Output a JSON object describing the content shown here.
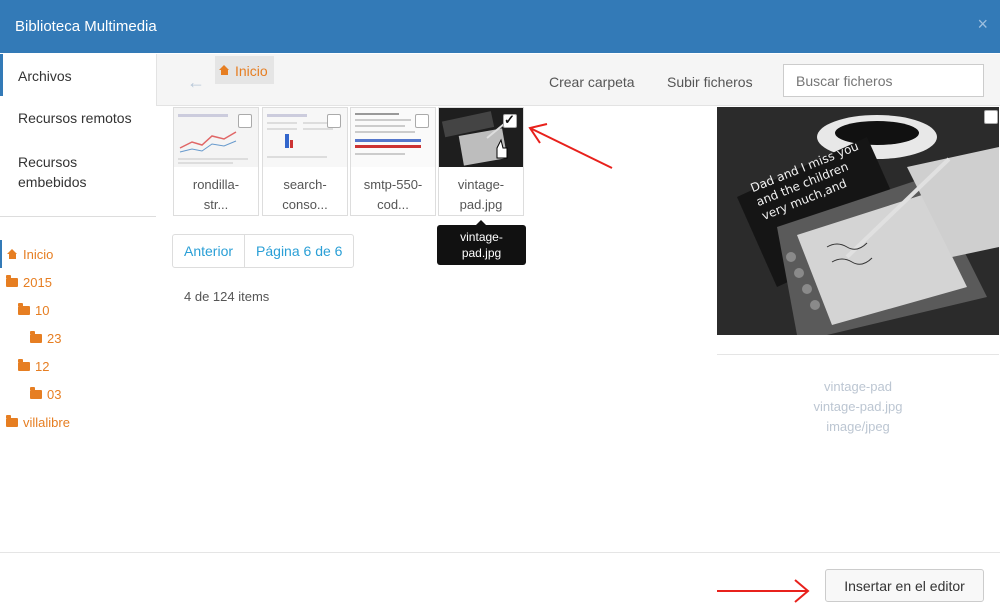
{
  "header": {
    "title": "Biblioteca Multimedia",
    "close": "×"
  },
  "sidebar": {
    "tabs": [
      {
        "label": "Archivos"
      },
      {
        "label": "Recursos remotos"
      },
      {
        "label": "Recursos embebidos"
      }
    ]
  },
  "tree": {
    "items": [
      {
        "label": "Inicio",
        "icon": "home-icon"
      },
      {
        "label": "2015",
        "icon": "folder-icon"
      },
      {
        "label": "10",
        "icon": "folder-icon"
      },
      {
        "label": "23",
        "icon": "folder-icon"
      },
      {
        "label": "12",
        "icon": "folder-icon"
      },
      {
        "label": "03",
        "icon": "folder-icon"
      },
      {
        "label": "villalibre",
        "icon": "folder-icon"
      }
    ]
  },
  "toolbar": {
    "back": "←",
    "breadcrumb": "Inicio",
    "create_folder": "Crear carpeta",
    "upload": "Subir ficheros",
    "search_placeholder": "Buscar ficheros"
  },
  "files": [
    {
      "line1": "rondilla-",
      "line2": "str...",
      "checked": false
    },
    {
      "line1": "search-",
      "line2": "conso...",
      "checked": false
    },
    {
      "line1": "smtp-550-",
      "line2": "cod...",
      "checked": false
    },
    {
      "line1": "vintage-",
      "line2": "pad.jpg",
      "checked": true
    }
  ],
  "tooltip": {
    "line1": "vintage-",
    "line2": "pad.jpg"
  },
  "pagination": {
    "prev": "Anterior",
    "page": "Página 6 de 6"
  },
  "item_count": "4 de 124 items",
  "preview": {
    "sign_text": [
      "Dad and I miss you",
      "and the children",
      "very much,and"
    ],
    "name": "vintage-pad",
    "filename": "vintage-pad.jpg",
    "mime": "image/jpeg"
  },
  "footer": {
    "insert_label": "Insertar en el editor"
  },
  "colors": {
    "header": "#337ab7",
    "folder": "#e67e22",
    "link": "#2a9fd6",
    "annotation": "#e8211c"
  }
}
